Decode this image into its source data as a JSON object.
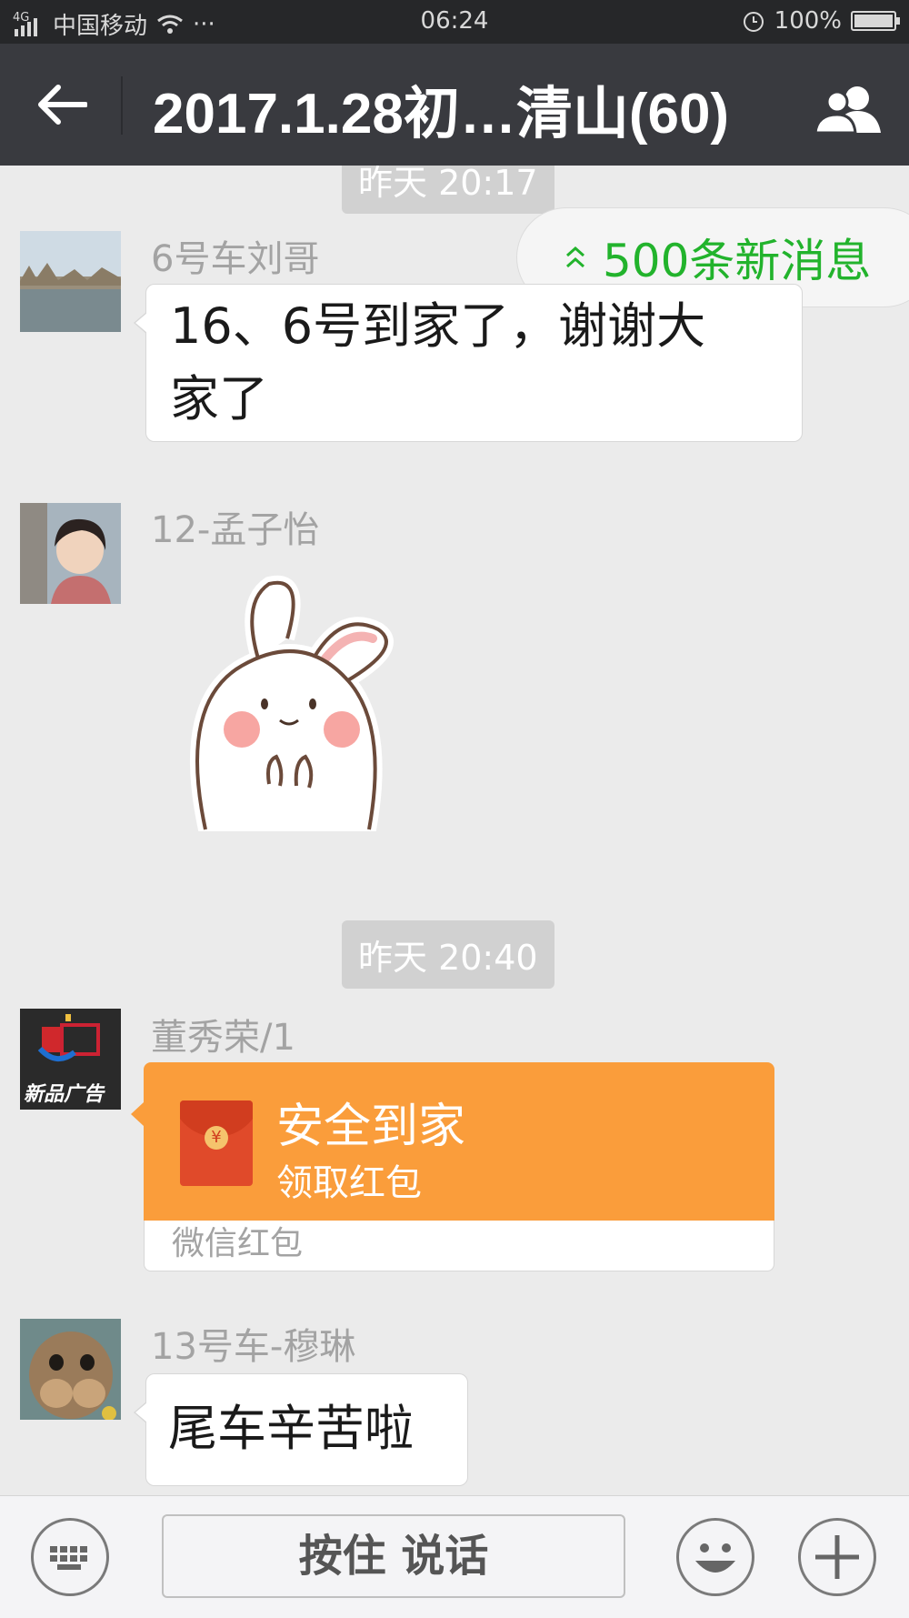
{
  "status_bar": {
    "network": "4G",
    "carrier": "中国移动",
    "dots": "···",
    "time": "06:24",
    "battery": "100%"
  },
  "nav": {
    "title": "2017.1.28初…清山(60)",
    "back_icon": "arrow-left-icon",
    "members_icon": "group-members-icon"
  },
  "chat": {
    "new_messages": "500条新消息",
    "time_top": "昨天 20:17",
    "time_mid": "昨天 20:40",
    "messages": [
      {
        "sender": "6号车刘哥",
        "text_line1": "16、6号到家了，谢谢大",
        "text_line2": "家了"
      },
      {
        "sender": "12-孟子怡",
        "sticker": "bunny-sticker"
      },
      {
        "sender": "董秀荣/1",
        "red_packet": {
          "title": "安全到家",
          "action": "领取红包",
          "footer": "微信红包"
        },
        "avatar_text": "新品广告"
      },
      {
        "sender": "13号车-穆琳",
        "text": "尾车辛苦啦"
      }
    ]
  },
  "bottom": {
    "talk_label": "按住 说话",
    "keyboard_icon": "keyboard-icon",
    "emoji_icon": "emoji-icon",
    "plus_icon": "plus-icon"
  },
  "colors": {
    "nav_bg": "#393a3f",
    "chat_bg": "#ebebeb",
    "red_packet": "#fa9d3b",
    "new_msg_green": "#22b32c"
  }
}
